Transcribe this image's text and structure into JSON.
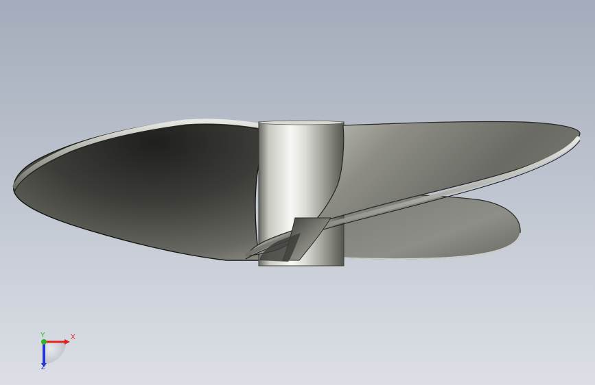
{
  "viewport": {
    "background": {
      "top": "#a3acbb",
      "bottom": "#dcdfe5"
    },
    "model": {
      "name": "propeller",
      "blade_count": 3,
      "colors": {
        "hub_light": "#f2f2ef",
        "hub_mid": "#bdbcb4",
        "hub_dark": "#4a4a44",
        "blade_dark": "#2f2f2c",
        "blade_mid": "#5e5e58",
        "blade_light": "#a9a9a2",
        "edge": "#1e1e1c",
        "rim": "#d8d8d2"
      }
    }
  },
  "triad": {
    "x_label": "X",
    "y_label": "Y",
    "z_label": "Z",
    "x_color": "#e0231f",
    "y_color": "#2fb52a",
    "z_color": "#2533d6"
  }
}
